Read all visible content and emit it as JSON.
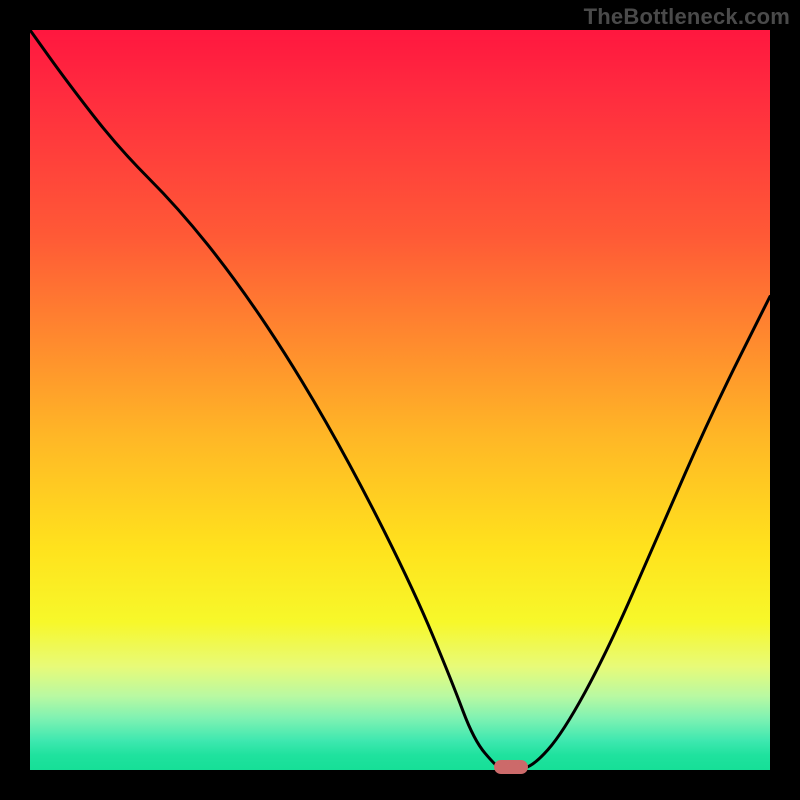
{
  "watermark": "TheBottleneck.com",
  "chart_data": {
    "type": "line",
    "title": "",
    "xlabel": "",
    "ylabel": "",
    "xlim": [
      0,
      100
    ],
    "ylim": [
      0,
      100
    ],
    "grid": false,
    "legend": false,
    "background_gradient": {
      "top": "#ff173f",
      "mid": "#ffe21d",
      "bottom": "#16df97"
    },
    "series": [
      {
        "name": "bottleneck-curve",
        "color": "#000000",
        "x": [
          0,
          5,
          12,
          20,
          28,
          36,
          44,
          52,
          57,
          60,
          63,
          64,
          65.5,
          68,
          72,
          78,
          85,
          92,
          100
        ],
        "y": [
          100,
          93,
          84,
          76,
          66,
          54,
          40,
          24,
          12,
          4,
          0.5,
          0,
          0,
          0.5,
          5,
          16,
          32,
          48,
          64
        ]
      }
    ],
    "marker": {
      "name": "valley-marker",
      "x": 65,
      "y": 0,
      "color": "#cc6a6a",
      "shape": "pill"
    }
  }
}
